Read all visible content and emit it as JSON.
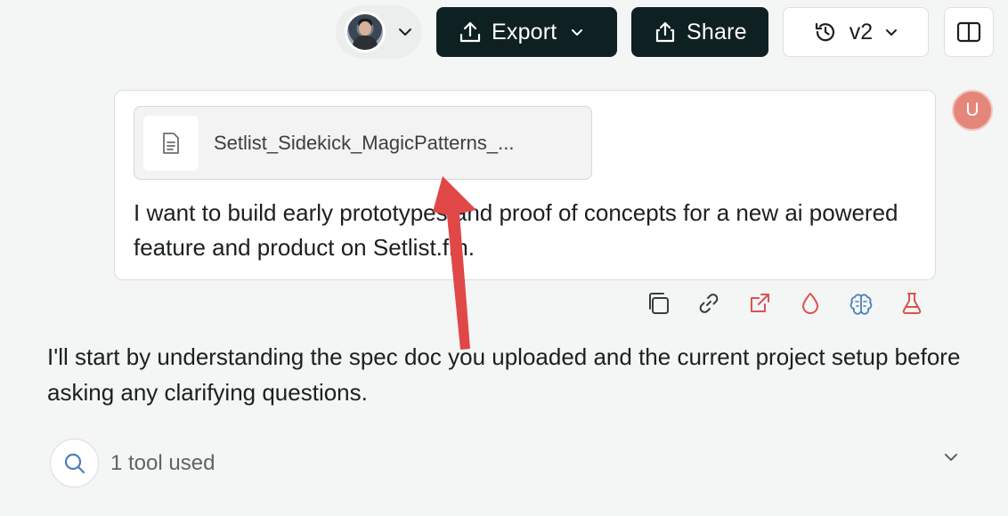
{
  "toolbar": {
    "avatar_alt": "user avatar",
    "export_label": "Export",
    "share_label": "Share",
    "version_label": "v2"
  },
  "message": {
    "attachment_name": "Setlist_Sidekick_MagicPatterns_...",
    "text": "I want to build early prototypes and proof of concepts for a new ai powered feature and product on Setlist.fm.",
    "user_initial": "U"
  },
  "message_actions": [
    "copy-icon",
    "link-icon",
    "external-link-icon",
    "droplet-icon",
    "brain-icon",
    "flask-icon"
  ],
  "assistant": {
    "text": "I'll start by understanding the spec doc you uploaded and the current project setup before asking any clarifying questions."
  },
  "tools": {
    "label": "1 tool used"
  },
  "colors": {
    "dark_button": "#0f2022",
    "accent_red": "#e04747",
    "user_badge": "#e48679",
    "action_icon_red": "#d9534f",
    "action_icon_blue": "#4a7fb8"
  }
}
